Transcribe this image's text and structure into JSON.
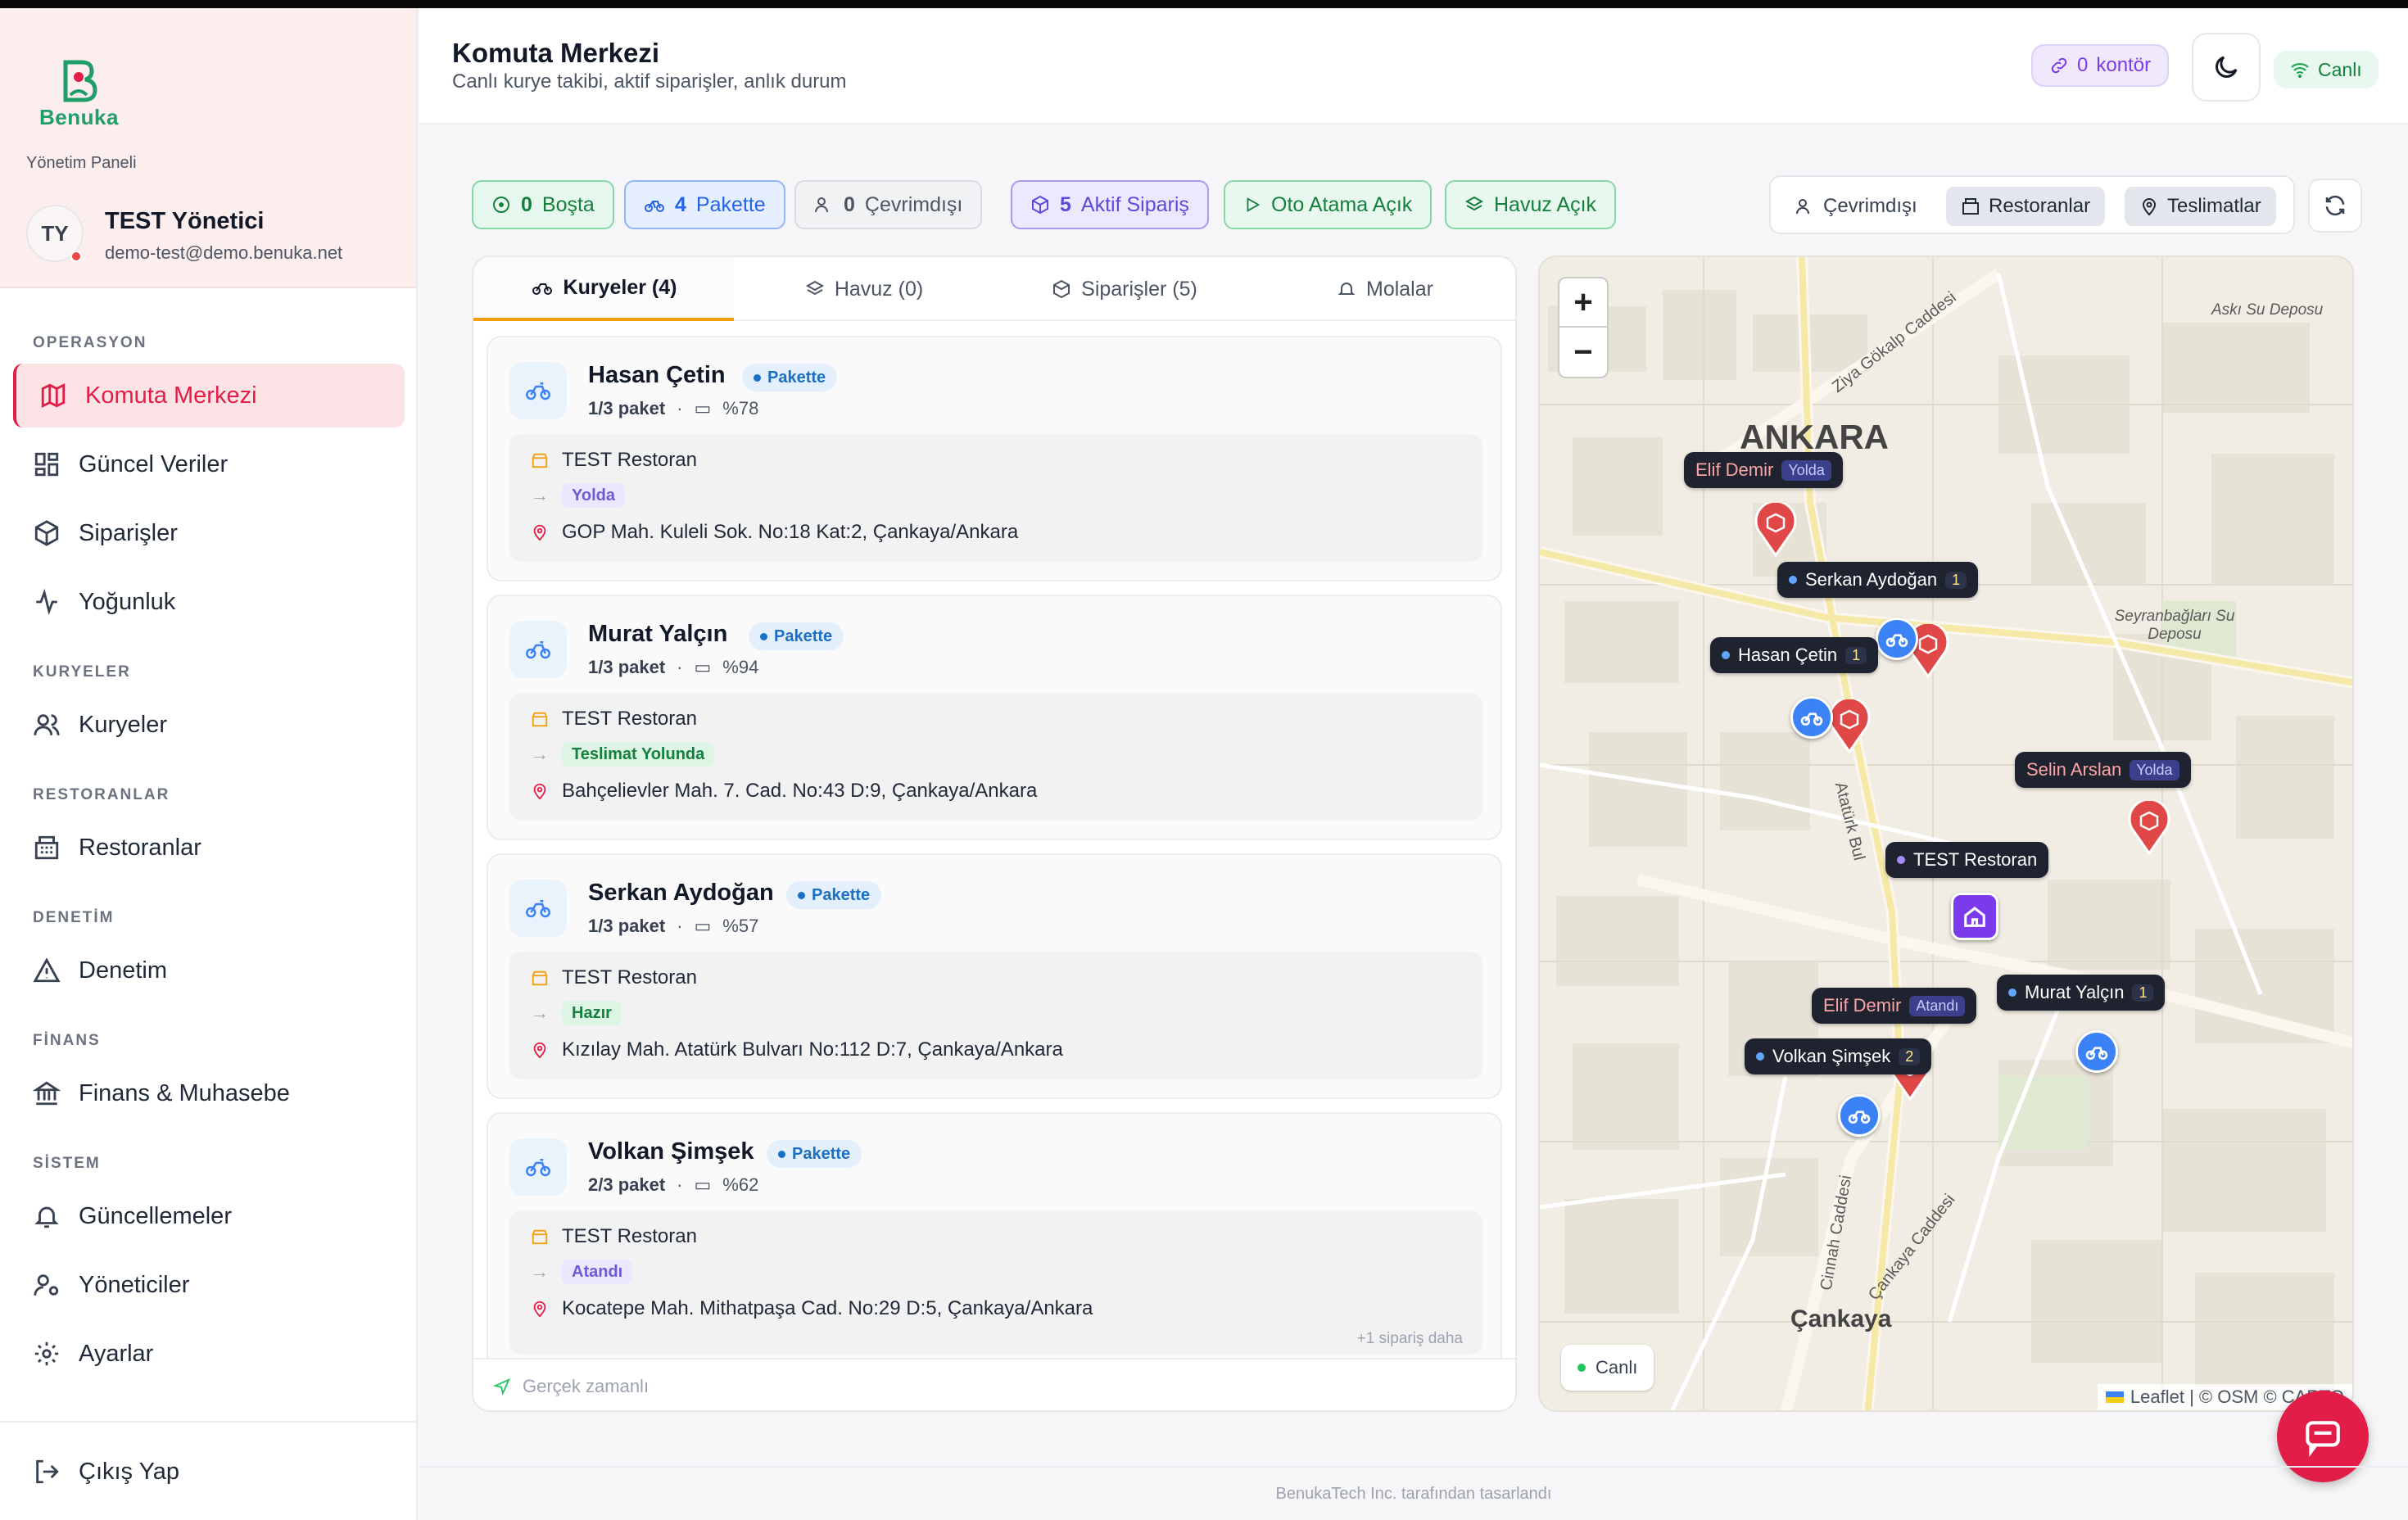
{
  "sidebar": {
    "logo_text": "Benuka",
    "panel_label": "Yönetim Paneli",
    "user": {
      "initials": "TY",
      "name": "TEST Yönetici",
      "email": "demo-test@demo.benuka.net"
    },
    "sections": {
      "operasyon": "OPERASYON",
      "kuryeler": "KURYELER",
      "restoranlar": "RESTORANLAR",
      "denetim": "DENETİM",
      "finans": "FİNANS",
      "sistem": "SİSTEM"
    },
    "items": {
      "komuta": "Komuta Merkezi",
      "guncel": "Güncel Veriler",
      "siparisler": "Siparişler",
      "yogunluk": "Yoğunluk",
      "kuryeler": "Kuryeler",
      "restoranlar": "Restoranlar",
      "denetim": "Denetim",
      "finans": "Finans & Muhasebe",
      "guncellemeler": "Güncellemeler",
      "yoneticiler": "Yöneticiler",
      "ayarlar": "Ayarlar",
      "cikis": "Çıkış Yap"
    }
  },
  "header": {
    "title": "Komuta Merkezi",
    "subtitle": "Canlı kurye takibi, aktif siparişler, anlık durum",
    "kontor_count": "0",
    "kontor_label": "kontör",
    "live_label": "Canlı"
  },
  "filters": {
    "bosta": {
      "count": "0",
      "label": "Boşta"
    },
    "pakette": {
      "count": "4",
      "label": "Pakette"
    },
    "cevrimdisi": {
      "count": "0",
      "label": "Çevrimdışı"
    },
    "aktif": {
      "count": "5",
      "label": "Aktif Sipariş"
    },
    "oto_atama": "Oto Atama Açık",
    "havuz": "Havuz Açık"
  },
  "map_toggle": {
    "cevrimdisi": "Çevrimdışı",
    "restoranlar": "Restoranlar",
    "teslimatlar": "Teslimatlar"
  },
  "tabs": {
    "kuryeler": "Kuryeler (4)",
    "havuz": "Havuz (0)",
    "siparisler": "Siparişler (5)",
    "molalar": "Molalar"
  },
  "couriers": [
    {
      "name": "Hasan Çetin",
      "badge": "Pakette",
      "packages": "1/3 paket",
      "battery": "%78",
      "restaurant": "TEST Restoran",
      "status": "Yolda",
      "address": "GOP Mah. Kuleli Sok. No:18 Kat:2, Çankaya/Ankara"
    },
    {
      "name": "Murat Yalçın",
      "badge": "Pakette",
      "packages": "1/3 paket",
      "battery": "%94",
      "restaurant": "TEST Restoran",
      "status": "Teslimat Yolunda",
      "address": "Bahçelievler Mah. 7. Cad. No:43 D:9, Çankaya/Ankara"
    },
    {
      "name": "Serkan Aydoğan",
      "badge": "Pakette",
      "packages": "1/3 paket",
      "battery": "%57",
      "restaurant": "TEST Restoran",
      "status": "Hazır",
      "address": "Kızılay Mah. Atatürk Bulvarı No:112 D:7, Çankaya/Ankara"
    },
    {
      "name": "Volkan Şimşek",
      "badge": "Pakette",
      "packages": "2/3 paket",
      "battery": "%62",
      "restaurant": "TEST Restoran",
      "status": "Atandı",
      "address": "Kocatepe Mah. Mithatpaşa Cad. No:29 D:5, Çankaya/Ankara",
      "more": "+1 sipariş daha"
    }
  ],
  "panel_footer": "Gerçek zamanlı",
  "map": {
    "city": "ANKARA",
    "district": "Çankaya",
    "places": {
      "asku": "Askı Su Deposu",
      "seyranbaglari": "Seyranbağları Su Deposu"
    },
    "streets": {
      "ziya": "Ziya Gökalp Caddesi",
      "ataturk": "Atatürk Bul",
      "cinnah": "Cinnah Caddesi",
      "cankaya": "Çankaya Caddesi"
    },
    "labels": {
      "elif1_name": "Elif Demir",
      "elif1_status": "Yolda",
      "serkan_name": "Serkan Aydoğan",
      "serkan_count": "1",
      "hasan_name": "Hasan Çetin",
      "hasan_count": "1",
      "selin_name": "Selin Arslan",
      "selin_status": "Yolda",
      "restaurant": "TEST Restoran",
      "elif2_name": "Elif Demir",
      "elif2_status": "Atandı",
      "murat_name": "Murat Yalçın",
      "murat_count": "1",
      "volkan_name": "Volkan Şimşek",
      "volkan_count": "2"
    },
    "live_label": "Canlı",
    "attribution": "Leaflet | © OSM © CARTO"
  },
  "footer": "BenukaTech Inc. tarafından tasarlandı",
  "colors": {
    "accent": "#e11d48",
    "courier": "#3b82f6",
    "order": "#e04848",
    "restaurant": "#7c3aed"
  }
}
